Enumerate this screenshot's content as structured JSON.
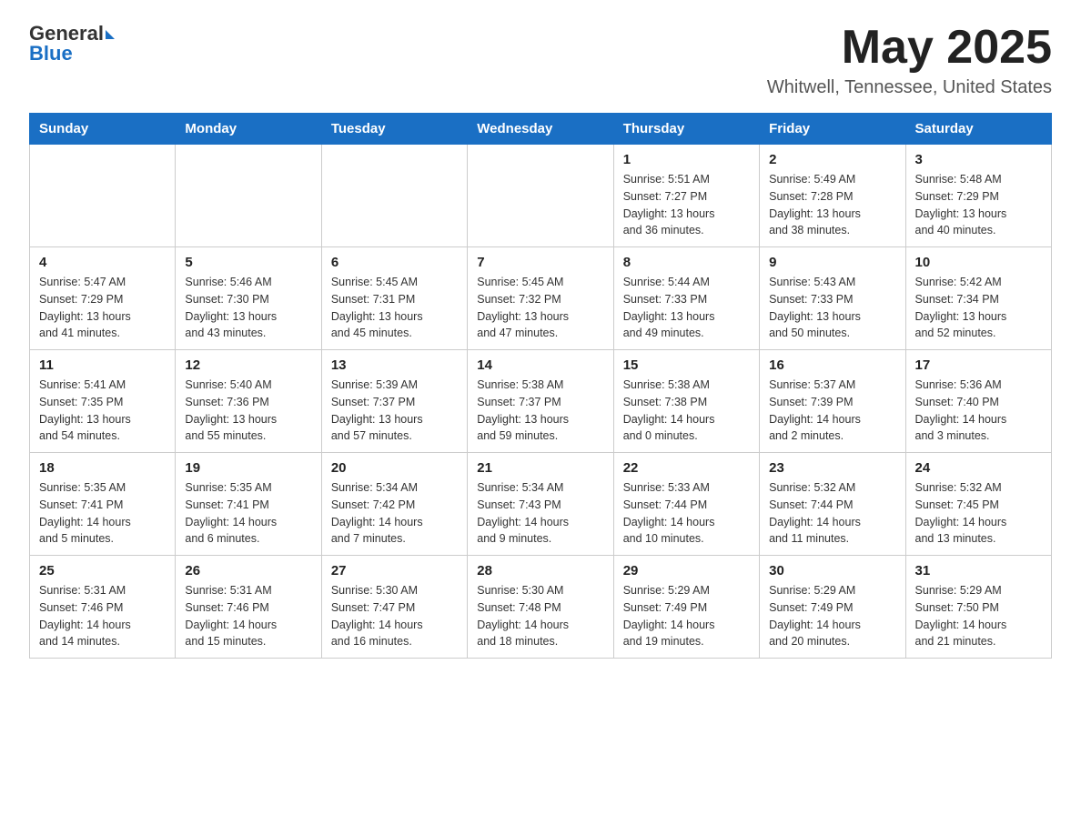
{
  "header": {
    "logo_text_general": "General",
    "logo_text_blue": "Blue",
    "month_title": "May 2025",
    "location": "Whitwell, Tennessee, United States"
  },
  "days_of_week": [
    "Sunday",
    "Monday",
    "Tuesday",
    "Wednesday",
    "Thursday",
    "Friday",
    "Saturday"
  ],
  "weeks": [
    [
      {
        "day": "",
        "info": ""
      },
      {
        "day": "",
        "info": ""
      },
      {
        "day": "",
        "info": ""
      },
      {
        "day": "",
        "info": ""
      },
      {
        "day": "1",
        "info": "Sunrise: 5:51 AM\nSunset: 7:27 PM\nDaylight: 13 hours\nand 36 minutes."
      },
      {
        "day": "2",
        "info": "Sunrise: 5:49 AM\nSunset: 7:28 PM\nDaylight: 13 hours\nand 38 minutes."
      },
      {
        "day": "3",
        "info": "Sunrise: 5:48 AM\nSunset: 7:29 PM\nDaylight: 13 hours\nand 40 minutes."
      }
    ],
    [
      {
        "day": "4",
        "info": "Sunrise: 5:47 AM\nSunset: 7:29 PM\nDaylight: 13 hours\nand 41 minutes."
      },
      {
        "day": "5",
        "info": "Sunrise: 5:46 AM\nSunset: 7:30 PM\nDaylight: 13 hours\nand 43 minutes."
      },
      {
        "day": "6",
        "info": "Sunrise: 5:45 AM\nSunset: 7:31 PM\nDaylight: 13 hours\nand 45 minutes."
      },
      {
        "day": "7",
        "info": "Sunrise: 5:45 AM\nSunset: 7:32 PM\nDaylight: 13 hours\nand 47 minutes."
      },
      {
        "day": "8",
        "info": "Sunrise: 5:44 AM\nSunset: 7:33 PM\nDaylight: 13 hours\nand 49 minutes."
      },
      {
        "day": "9",
        "info": "Sunrise: 5:43 AM\nSunset: 7:33 PM\nDaylight: 13 hours\nand 50 minutes."
      },
      {
        "day": "10",
        "info": "Sunrise: 5:42 AM\nSunset: 7:34 PM\nDaylight: 13 hours\nand 52 minutes."
      }
    ],
    [
      {
        "day": "11",
        "info": "Sunrise: 5:41 AM\nSunset: 7:35 PM\nDaylight: 13 hours\nand 54 minutes."
      },
      {
        "day": "12",
        "info": "Sunrise: 5:40 AM\nSunset: 7:36 PM\nDaylight: 13 hours\nand 55 minutes."
      },
      {
        "day": "13",
        "info": "Sunrise: 5:39 AM\nSunset: 7:37 PM\nDaylight: 13 hours\nand 57 minutes."
      },
      {
        "day": "14",
        "info": "Sunrise: 5:38 AM\nSunset: 7:37 PM\nDaylight: 13 hours\nand 59 minutes."
      },
      {
        "day": "15",
        "info": "Sunrise: 5:38 AM\nSunset: 7:38 PM\nDaylight: 14 hours\nand 0 minutes."
      },
      {
        "day": "16",
        "info": "Sunrise: 5:37 AM\nSunset: 7:39 PM\nDaylight: 14 hours\nand 2 minutes."
      },
      {
        "day": "17",
        "info": "Sunrise: 5:36 AM\nSunset: 7:40 PM\nDaylight: 14 hours\nand 3 minutes."
      }
    ],
    [
      {
        "day": "18",
        "info": "Sunrise: 5:35 AM\nSunset: 7:41 PM\nDaylight: 14 hours\nand 5 minutes."
      },
      {
        "day": "19",
        "info": "Sunrise: 5:35 AM\nSunset: 7:41 PM\nDaylight: 14 hours\nand 6 minutes."
      },
      {
        "day": "20",
        "info": "Sunrise: 5:34 AM\nSunset: 7:42 PM\nDaylight: 14 hours\nand 7 minutes."
      },
      {
        "day": "21",
        "info": "Sunrise: 5:34 AM\nSunset: 7:43 PM\nDaylight: 14 hours\nand 9 minutes."
      },
      {
        "day": "22",
        "info": "Sunrise: 5:33 AM\nSunset: 7:44 PM\nDaylight: 14 hours\nand 10 minutes."
      },
      {
        "day": "23",
        "info": "Sunrise: 5:32 AM\nSunset: 7:44 PM\nDaylight: 14 hours\nand 11 minutes."
      },
      {
        "day": "24",
        "info": "Sunrise: 5:32 AM\nSunset: 7:45 PM\nDaylight: 14 hours\nand 13 minutes."
      }
    ],
    [
      {
        "day": "25",
        "info": "Sunrise: 5:31 AM\nSunset: 7:46 PM\nDaylight: 14 hours\nand 14 minutes."
      },
      {
        "day": "26",
        "info": "Sunrise: 5:31 AM\nSunset: 7:46 PM\nDaylight: 14 hours\nand 15 minutes."
      },
      {
        "day": "27",
        "info": "Sunrise: 5:30 AM\nSunset: 7:47 PM\nDaylight: 14 hours\nand 16 minutes."
      },
      {
        "day": "28",
        "info": "Sunrise: 5:30 AM\nSunset: 7:48 PM\nDaylight: 14 hours\nand 18 minutes."
      },
      {
        "day": "29",
        "info": "Sunrise: 5:29 AM\nSunset: 7:49 PM\nDaylight: 14 hours\nand 19 minutes."
      },
      {
        "day": "30",
        "info": "Sunrise: 5:29 AM\nSunset: 7:49 PM\nDaylight: 14 hours\nand 20 minutes."
      },
      {
        "day": "31",
        "info": "Sunrise: 5:29 AM\nSunset: 7:50 PM\nDaylight: 14 hours\nand 21 minutes."
      }
    ]
  ]
}
